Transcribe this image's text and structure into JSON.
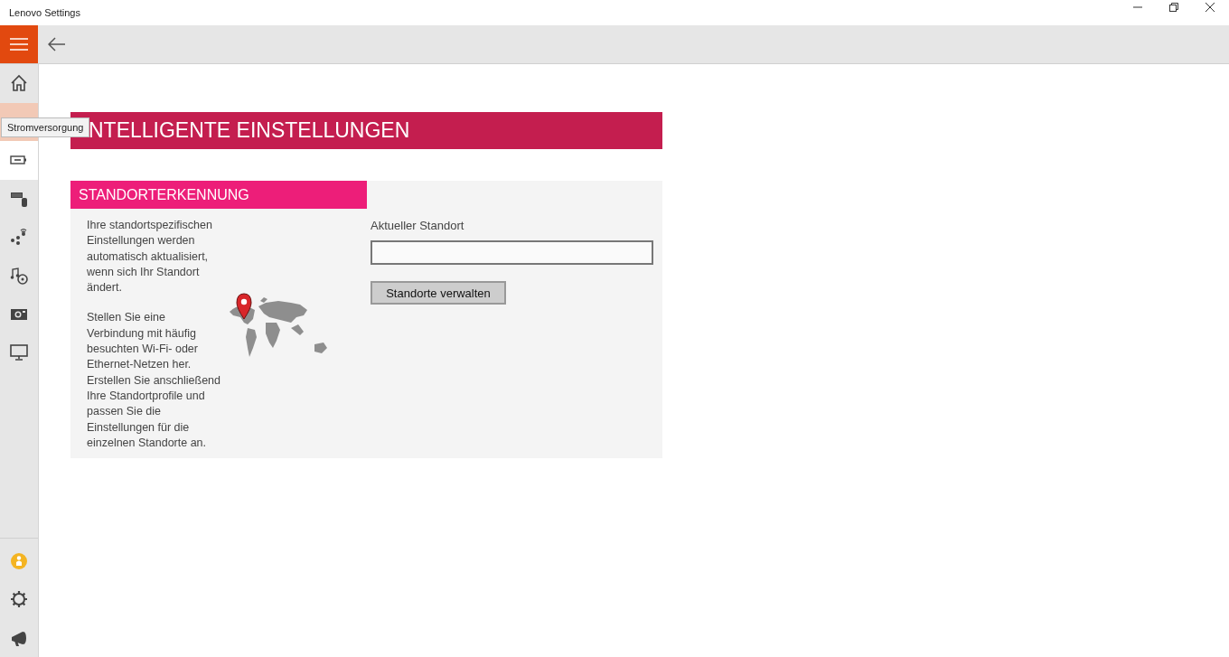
{
  "window": {
    "title": "Lenovo Settings"
  },
  "nav_items": [
    {
      "kind": "home",
      "selected": false,
      "hovered": false
    },
    {
      "kind": "power",
      "selected": false,
      "hovered": true
    },
    {
      "kind": "battery",
      "selected": true,
      "hovered": false
    },
    {
      "kind": "input",
      "selected": false,
      "hovered": false
    },
    {
      "kind": "network",
      "selected": false,
      "hovered": false
    },
    {
      "kind": "media",
      "selected": false,
      "hovered": false
    },
    {
      "kind": "camera",
      "selected": false,
      "hovered": false
    },
    {
      "kind": "display",
      "selected": false,
      "hovered": false
    }
  ],
  "nav_bottom": [
    {
      "kind": "badge"
    },
    {
      "kind": "settings"
    },
    {
      "kind": "feedback"
    }
  ],
  "tooltip": "Stromversorgung",
  "page_title": "NTELLIGENTE EINSTELLUNGEN",
  "section": {
    "title": "STANDORTERKENNUNG",
    "paragraphs": [
      "Ihre standortspezifischen Einstellungen werden automatisch aktualisiert, wenn sich Ihr Standort ändert.",
      "Stellen Sie eine Verbindung mit häufig besuchten Wi-Fi- oder Ethernet-Netzen her. Erstellen Sie anschließend Ihre Standortprofile und passen Sie die Einstellungen für die einzelnen Standorte an."
    ],
    "field_label": "Aktueller Standort",
    "button": "Standorte verwalten"
  }
}
